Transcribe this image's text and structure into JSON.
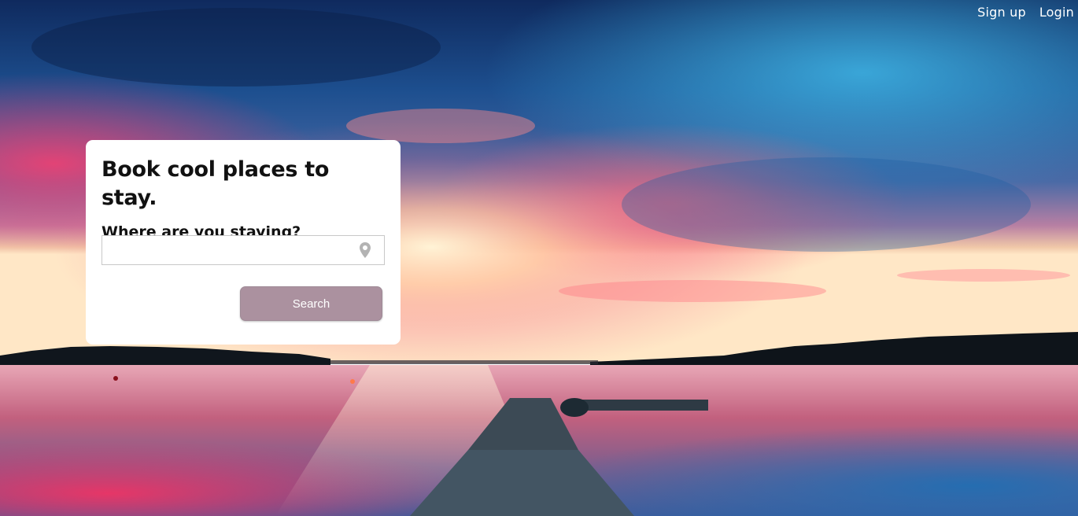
{
  "nav": {
    "signup_label": "Sign up",
    "login_label": "Login"
  },
  "card": {
    "title": "Book cool places to stay.",
    "subtitle": "Where are you staying?",
    "location_input": {
      "value": "",
      "placeholder": "",
      "icon": "map-pin-icon"
    },
    "search_label": "Search"
  },
  "colors": {
    "button_bg": "#ab919f",
    "card_bg": "#ffffff",
    "nav_text": "#ffffff",
    "pin_icon": "#b3b3b3"
  },
  "background": {
    "description_icon": "sunset-lake-dock-photo"
  }
}
